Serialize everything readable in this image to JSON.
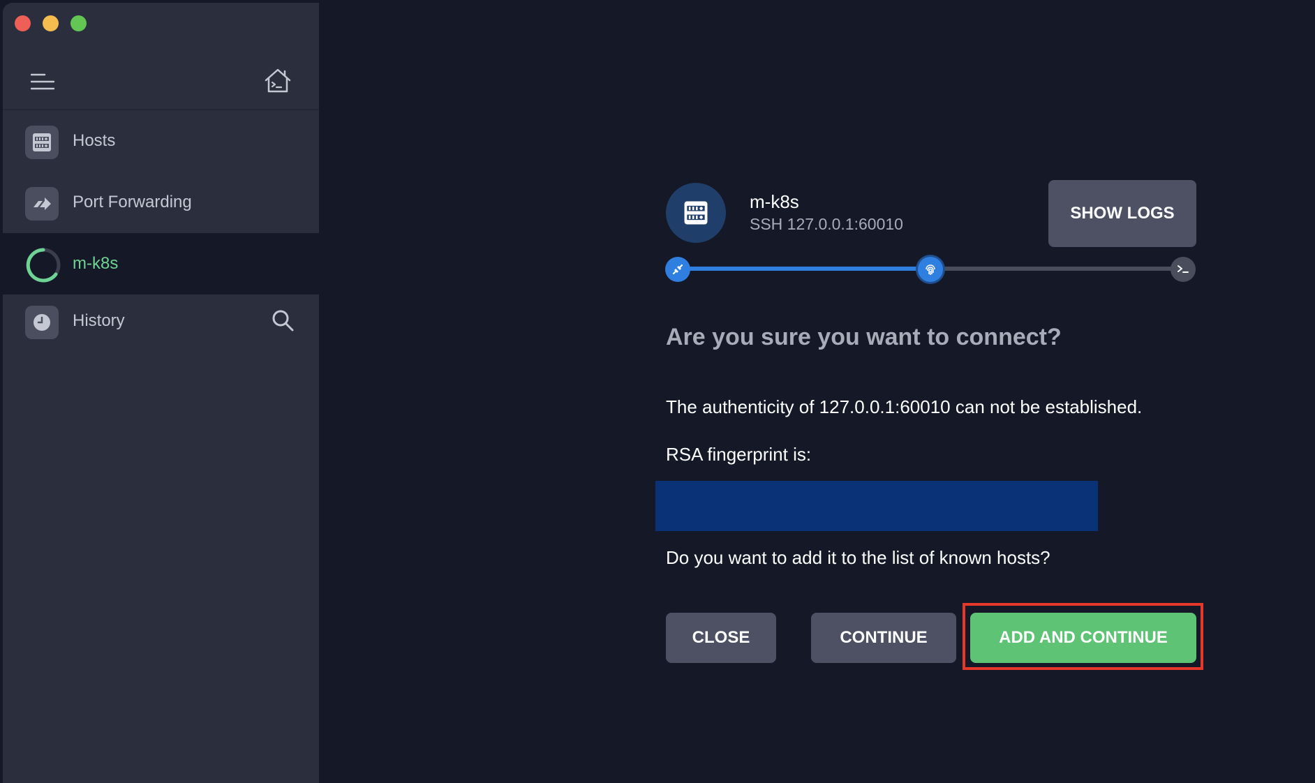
{
  "window": {
    "traffic_lights": {
      "close_color": "#ed5f57",
      "minimize_color": "#f5bd4f",
      "maximize_color": "#62c554"
    }
  },
  "sidebar": {
    "header": {
      "menu_icon": "hamburger-menu-icon",
      "home_icon": "home-terminal-icon"
    },
    "items": [
      {
        "label": "Hosts",
        "icon": "server-icon"
      },
      {
        "label": "Port Forwarding",
        "icon": "port-forward-icon"
      },
      {
        "label": "m-k8s",
        "icon": "loading-spinner-icon",
        "active": true
      },
      {
        "label": "History",
        "icon": "clock-icon"
      }
    ],
    "history_search_icon": "search-icon"
  },
  "connection": {
    "host_name": "m-k8s",
    "host_address": "SSH 127.0.0.1:60010",
    "show_logs_label": "SHOW LOGS",
    "progress": {
      "steps": [
        "connect-icon",
        "fingerprint-icon",
        "terminal-icon"
      ],
      "current_step": 2,
      "completed_fraction": 0.5
    },
    "colors": {
      "accent_blue": "#2f7fe0",
      "success_green": "#5ec375",
      "highlight_red": "#e5382b"
    }
  },
  "dialog": {
    "title": "Are you sure you want to connect?",
    "authenticity_message": "The authenticity of 127.0.0.1:60010 can not be established.",
    "fingerprint_label": "RSA fingerprint is:",
    "question": "Do you want to add it to the list of known hosts?",
    "buttons": {
      "close": "CLOSE",
      "continue": "CONTINUE",
      "add_and_continue": "ADD AND CONTINUE"
    }
  }
}
